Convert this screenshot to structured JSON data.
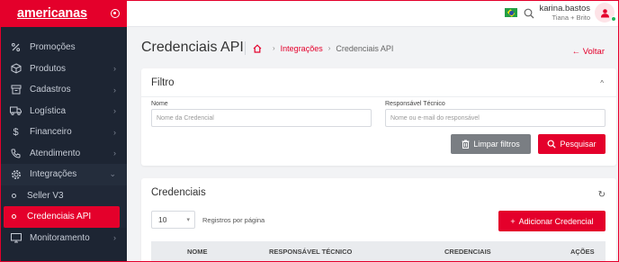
{
  "brand": {
    "logo": "americanas"
  },
  "sidebar": {
    "items": [
      {
        "label": "Promoções",
        "icon": "percent-icon",
        "has_children": false
      },
      {
        "label": "Produtos",
        "icon": "box-icon",
        "has_children": true
      },
      {
        "label": "Cadastros",
        "icon": "archive-icon",
        "has_children": true
      },
      {
        "label": "Logística",
        "icon": "truck-icon",
        "has_children": true
      },
      {
        "label": "Financeiro",
        "icon": "dollar-icon",
        "has_children": true
      },
      {
        "label": "Atendimento",
        "icon": "phone-icon",
        "has_children": true
      },
      {
        "label": "Integrações",
        "icon": "gear-icon",
        "has_children": true,
        "open": true
      }
    ],
    "subitems": [
      {
        "label": "Seller V3",
        "active": false
      },
      {
        "label": "Credenciais API",
        "active": true
      }
    ],
    "after": [
      {
        "label": "Monitoramento",
        "icon": "monitor-icon",
        "has_children": true
      }
    ]
  },
  "topbar": {
    "language_flag": "brazil-flag",
    "user_name": "karina.bastos",
    "user_company": "Tiana + Brito"
  },
  "page": {
    "title": "Credenciais API",
    "breadcrumb": {
      "link": "Integrações",
      "current": "Credenciais API"
    },
    "back_label": "Voltar"
  },
  "filter": {
    "title": "Filtro",
    "name_label": "Nome",
    "name_placeholder": "Nome da Credencial",
    "tech_label": "Responsável Técnico",
    "tech_placeholder": "Nome ou e-mail do responsável",
    "clear_label": "Limpar filtros",
    "search_label": "Pesquisar"
  },
  "credentials": {
    "title": "Credenciais",
    "page_size": "10",
    "page_size_label": "Registros por página",
    "add_label": "Adicionar Credencial",
    "columns": [
      "NOME",
      "RESPONSÁVEL TÉCNICO",
      "CREDENCIAIS",
      "AÇÕES"
    ]
  },
  "colors": {
    "accent": "#e4002b",
    "sidebar_bg": "#1d2533",
    "grey_button": "#7a7e83"
  }
}
